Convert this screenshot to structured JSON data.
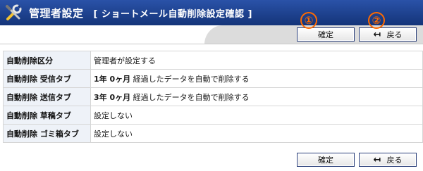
{
  "header": {
    "title": "管理者設定",
    "subtitle": "[ ショートメール自動削除設定確認 ]",
    "icon": "tools-icon"
  },
  "toolbar": {
    "confirm_label": "確定",
    "back_label": "戻る",
    "back_icon": "arrow-left-bar-icon"
  },
  "markers": [
    "①",
    "②"
  ],
  "settings": {
    "rows": [
      {
        "label": "自動削除区分",
        "value_parts": [
          "",
          "管理者が設定する"
        ]
      },
      {
        "label": "自動削除 受信タブ",
        "value_parts": [
          "1年 0ヶ月",
          " 経過したデータを自動で削除する"
        ]
      },
      {
        "label": "自動削除 送信タブ",
        "value_parts": [
          "3年 0ヶ月",
          " 経過したデータを自動で削除する"
        ]
      },
      {
        "label": "自動削除 草稿タブ",
        "value_parts": [
          "",
          "設定しない"
        ]
      },
      {
        "label": "自動削除 ゴミ箱タブ",
        "value_parts": [
          "",
          "設定しない"
        ]
      }
    ]
  },
  "colors": {
    "header_bg": "#1a3a86",
    "marker": "#ff6a00",
    "label_bg": "#eef2f8"
  }
}
